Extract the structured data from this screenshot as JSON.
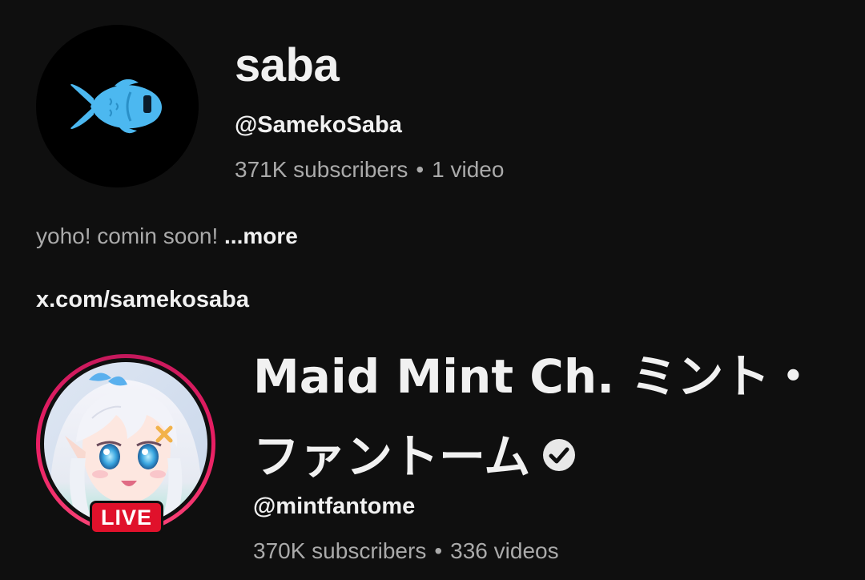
{
  "channel1": {
    "name": "saba",
    "handle": "@SamekoSaba",
    "subscribers": "371K subscribers",
    "separator": "•",
    "videos": "1 video",
    "description": "yoho! comin soon! ",
    "more_label": "...more",
    "link": "x.com/samekosaba",
    "avatar_icon": "fish-icon",
    "avatar_color": "#4cb8f0"
  },
  "channel2": {
    "name": "Maid Mint Ch. ミント・ファントーム",
    "handle": "@mintfantome",
    "subscribers": "370K subscribers",
    "separator": "•",
    "videos": "336 videos",
    "live_label": "LIVE",
    "verified_icon": "verified-check-icon",
    "live_ring_color": "#e91e63",
    "live_badge_color": "#e0112b"
  }
}
